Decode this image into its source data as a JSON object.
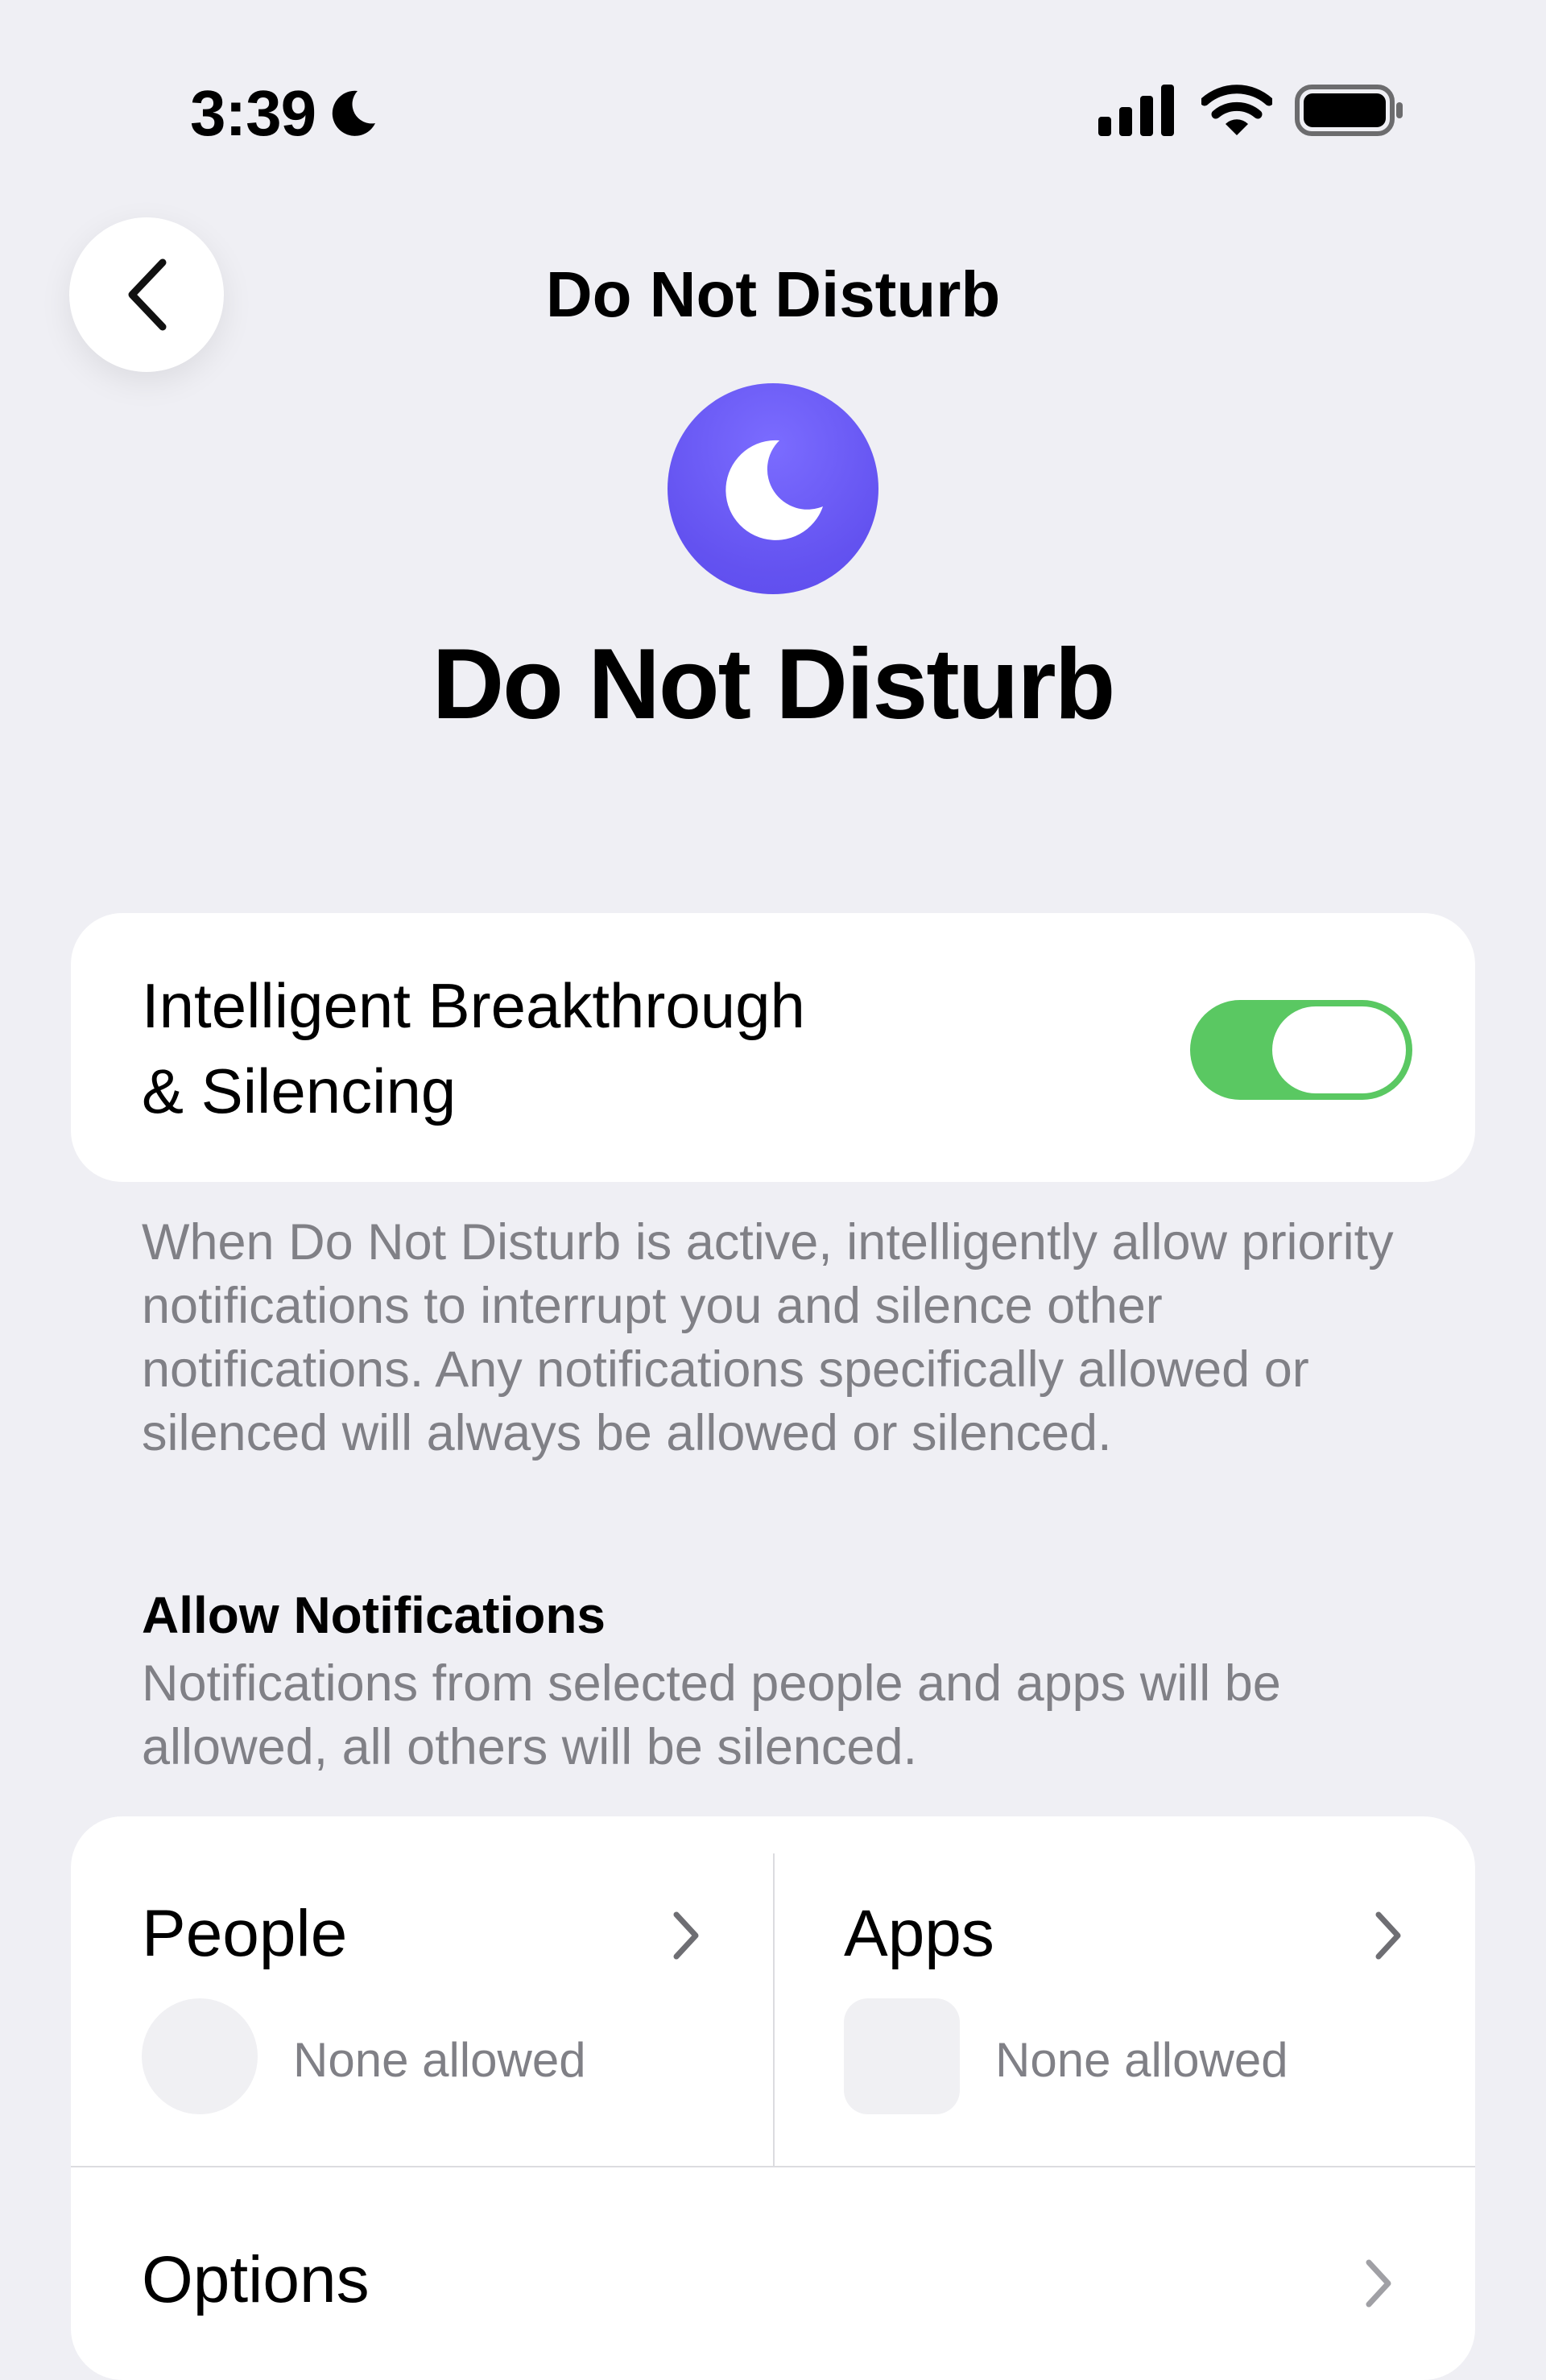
{
  "status_bar": {
    "time": "3:39"
  },
  "nav": {
    "title": "Do Not Disturb"
  },
  "hero": {
    "title": "Do Not Disturb",
    "icon": "moon-icon",
    "icon_color": "#6352f0"
  },
  "intelligent": {
    "label_line1": "Intelligent Breakthrough",
    "label_line2": "& Silencing",
    "enabled": true,
    "switch_color": "#5ac862",
    "footnote": "When Do Not Disturb is active, intelligently allow priority notifications to interrupt you and silence other notifications. Any notifications specifically allowed or silenced will always be allowed or silenced."
  },
  "allow_notifications": {
    "header": "Allow Notifications",
    "subtitle": "Notifications from selected people and apps will be allowed, all others will be silenced.",
    "people": {
      "label": "People",
      "status": "None allowed"
    },
    "apps": {
      "label": "Apps",
      "status": "None allowed"
    },
    "options": {
      "label": "Options"
    }
  }
}
